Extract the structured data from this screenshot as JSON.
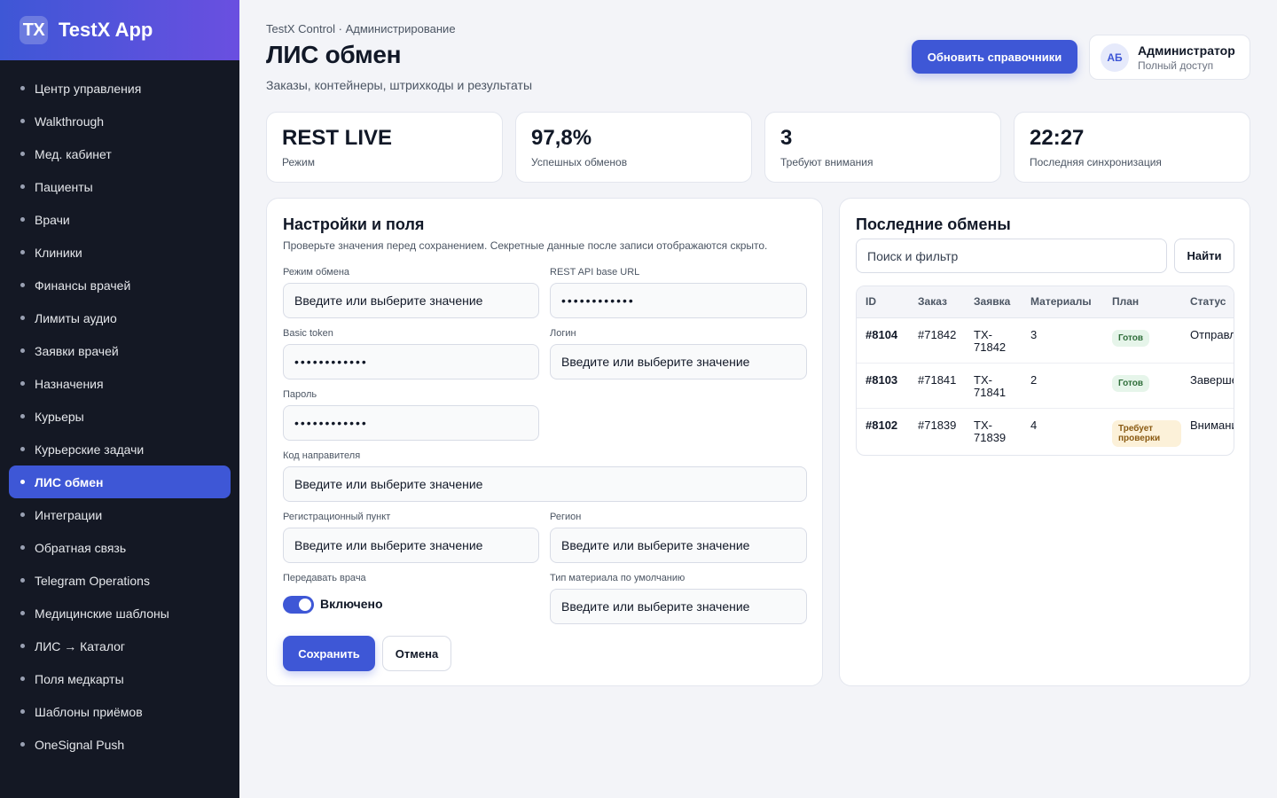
{
  "app": {
    "badge": "TX",
    "name": "TestX App"
  },
  "sidebar": {
    "items": [
      {
        "label": "Центр управления"
      },
      {
        "label": "Walkthrough"
      },
      {
        "label": "Мед. кабинет"
      },
      {
        "label": "Пациенты"
      },
      {
        "label": "Врачи"
      },
      {
        "label": "Клиники"
      },
      {
        "label": "Финансы врачей"
      },
      {
        "label": "Лимиты аудио"
      },
      {
        "label": "Заявки врачей"
      },
      {
        "label": "Назначения"
      },
      {
        "label": "Курьеры"
      },
      {
        "label": "Курьерские задачи"
      },
      {
        "label": "ЛИС обмен"
      },
      {
        "label": "Интеграции"
      },
      {
        "label": "Обратная связь"
      },
      {
        "label": "Telegram Operations"
      },
      {
        "label": "Медицинские шаблоны"
      },
      {
        "label": "ЛИС → Каталог"
      },
      {
        "label": "Поля медкарты"
      },
      {
        "label": "Шаблоны приёмов"
      },
      {
        "label": "OneSignal Push"
      }
    ],
    "active_label": "ЛИС обмен"
  },
  "header": {
    "breadcrumb": "TestX Control · Администрирование",
    "title": "ЛИС обмен",
    "subtitle": "Заказы, контейнеры, штрихкоды и результаты",
    "refresh_label": "Обновить справочники"
  },
  "user": {
    "initials": "АБ",
    "name": "Администратор",
    "role": "Полный доступ"
  },
  "stats": [
    {
      "value": "REST LIVE",
      "label": "Режим"
    },
    {
      "value": "97,8%",
      "label": "Успешных обменов"
    },
    {
      "value": "3",
      "label": "Требуют внимания"
    },
    {
      "value": "22:27",
      "label": "Последняя синхронизация"
    }
  ],
  "form": {
    "title": "Настройки и поля",
    "hint": "Проверьте значения перед сохранением. Секретные данные после записи отображаются скрыто.",
    "fields": {
      "mode": {
        "label": "Режим обмена",
        "value": "Введите или выберите значение"
      },
      "base_url": {
        "label": "REST API base URL",
        "value": "••••••••••••"
      },
      "basic_token": {
        "label": "Basic token",
        "value": "••••••••••••"
      },
      "login": {
        "label": "Логин",
        "value": "Введите или выберите значение"
      },
      "password": {
        "label": "Пароль",
        "value": "••••••••••••"
      },
      "referrer_code": {
        "label": "Код направителя",
        "value": "Введите или выберите значение"
      },
      "reg_point": {
        "label": "Регистрационный пункт",
        "value": "Введите или выберите значение"
      },
      "region": {
        "label": "Регион",
        "value": "Введите или выберите значение"
      },
      "send_doctor": {
        "label": "Передавать врача",
        "value": "Включено",
        "enabled": true
      },
      "material_type": {
        "label": "Тип материала по умолчанию",
        "value": "Введите или выберите значение"
      }
    },
    "save_label": "Сохранить",
    "cancel_label": "Отмена"
  },
  "exchanges": {
    "title": "Последние обмены",
    "search_placeholder": "Поиск и фильтр",
    "search_button": "Найти",
    "columns": {
      "id": "ID",
      "order": "Заказ",
      "request": "Заявка",
      "materials": "Материалы",
      "plan": "План",
      "status": "Статус"
    },
    "rows": [
      {
        "id": "#8104",
        "order": "#71842",
        "request": "TX-71842",
        "materials": "3",
        "plan": "Готов",
        "status": "Отправлено"
      },
      {
        "id": "#8103",
        "order": "#71841",
        "request": "TX-71841",
        "materials": "2",
        "plan": "Готов",
        "status": "Завершено"
      },
      {
        "id": "#8102",
        "order": "#71839",
        "request": "TX-71839",
        "materials": "4",
        "plan": "Требует проверки",
        "status": "Внимание"
      }
    ]
  },
  "colors": {
    "accent": "#3e57d6",
    "sidebar_bg": "#141824",
    "ok": "#2f6e3a",
    "warn": "#8a5a12"
  }
}
